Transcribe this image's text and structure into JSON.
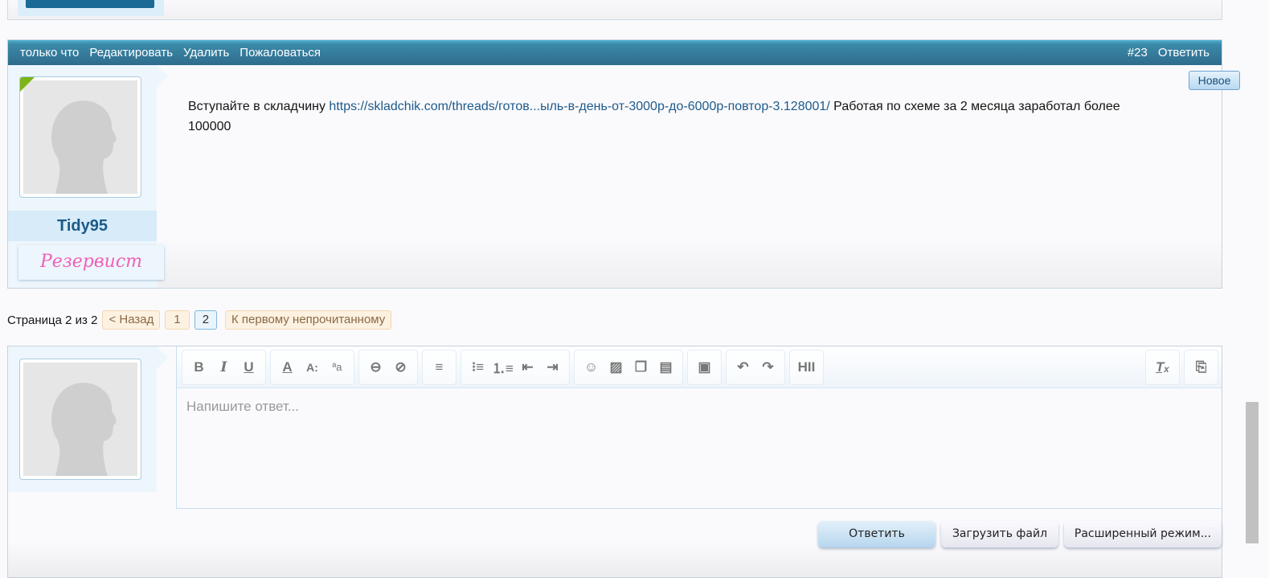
{
  "post": {
    "meta": {
      "time": "только что",
      "edit": "Редактировать",
      "delete": "Удалить",
      "report": "Пожаловаться",
      "number": "#23",
      "reply": "Ответить"
    },
    "user": {
      "name": "Tidy95",
      "rank": "Резервист"
    },
    "new_badge": "Новое",
    "message": {
      "before": "Вступайте в складчину ",
      "link": "https://skladchik.com/threads/готов...ыль-в-день-от-3000р-до-6000р-повтор-3.128001/",
      "after": " Работая по схеме за 2 месяца заработал более 100000"
    }
  },
  "pagination": {
    "label": "Страница 2 из 2",
    "prev": "< Назад",
    "pages": [
      "1",
      "2"
    ],
    "current": "2",
    "first_unread": "К первому непрочитанному"
  },
  "editor": {
    "placeholder": "Напишите ответ...",
    "hide_label": "HII",
    "buttons": {
      "reply": "Ответить",
      "upload": "Загрузить файл",
      "advanced": "Расширенный режим..."
    }
  },
  "colors": {
    "header_bar": "#2f6b8c",
    "link": "#1e5a8a",
    "username": "#1b5a86",
    "rank": "#f060b8"
  }
}
